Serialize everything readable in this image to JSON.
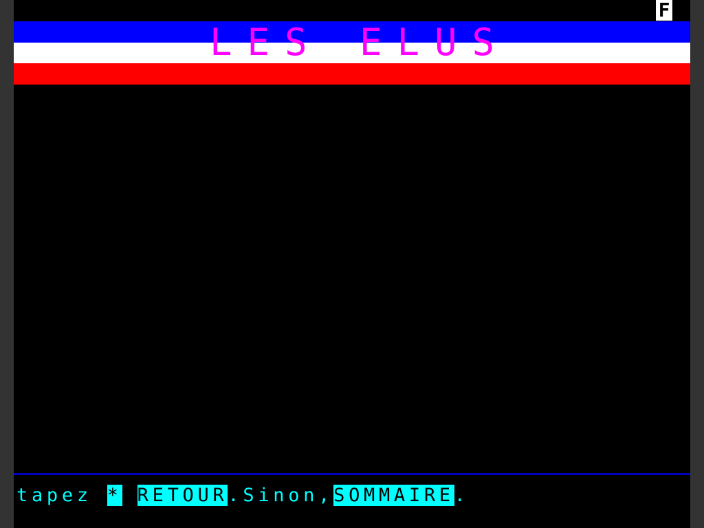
{
  "status": {
    "indicator": "F"
  },
  "header": {
    "title": "LES ELUS",
    "flag_colors": [
      "#0000ff",
      "#ffffff",
      "#ff0000"
    ],
    "title_color": "#ff00ff"
  },
  "footer": {
    "prefix": "tapez ",
    "key_star": "*",
    "gap": " ",
    "key_retour": "RETOUR",
    "middle": ".Sinon,",
    "key_sommaire": "SOMMAIRE",
    "suffix": ".",
    "text_color": "#00ffff",
    "divider_color": "#0000c0"
  }
}
